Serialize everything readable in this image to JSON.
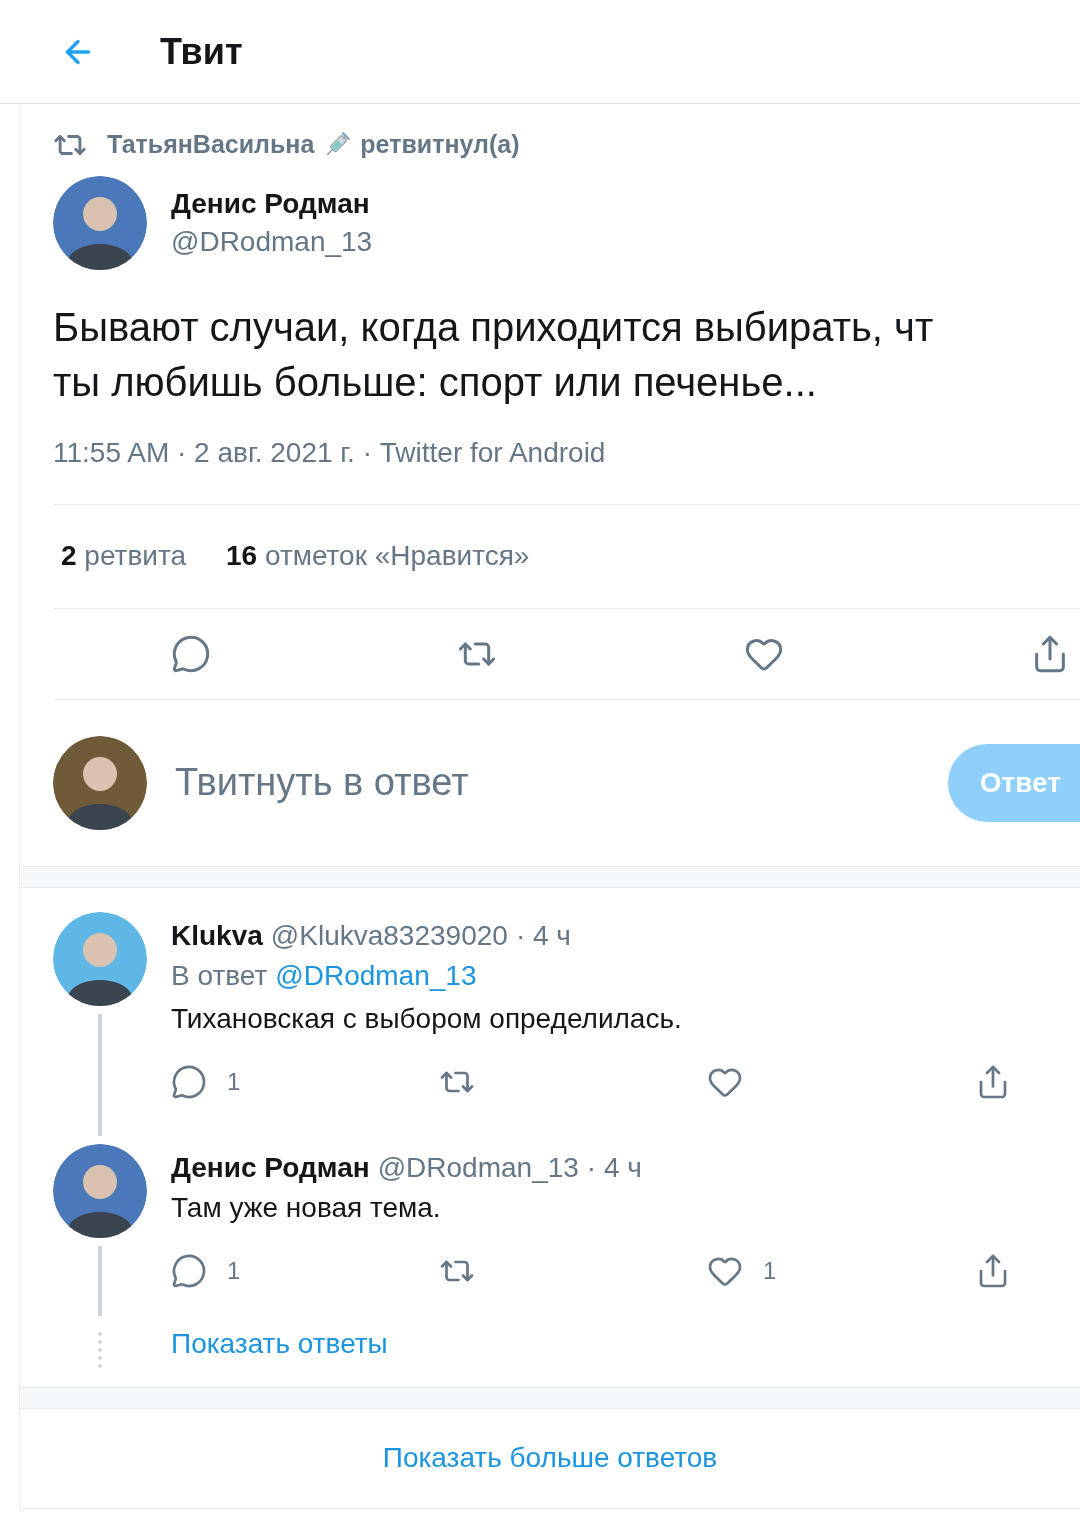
{
  "header": {
    "title": "Твит"
  },
  "retweet_banner": {
    "user": "ТатьянВасильна",
    "action": "ретвитнул(а)"
  },
  "tweet": {
    "author": "Денис Родман",
    "handle": "@DRodman_13",
    "text_lines": [
      "Бывают случаи, когда приходится выбирать, чт",
      "ты любишь больше: спорт или печенье..."
    ],
    "meta": "11:55 AM · 2 авг. 2021 г. · Twitter for Android",
    "stats": [
      {
        "count": "2",
        "label": "ретвита"
      },
      {
        "count": "16",
        "label": "отметок «Нравится»"
      }
    ],
    "actions": [
      {
        "kind": "reply"
      },
      {
        "kind": "retweet"
      },
      {
        "kind": "like"
      },
      {
        "kind": "share"
      }
    ]
  },
  "compose": {
    "placeholder": "Твитнуть в ответ",
    "button": "Ответ",
    "disabled": true
  },
  "replies": [
    {
      "author": "Klukva",
      "handle": "@Klukva83239020",
      "time": "· 4 ч",
      "reply_to_label": "В ответ",
      "reply_to": "@DRodman_13",
      "text": "Тихановская с выбором определилась.",
      "more_replies": false,
      "actions": [
        {
          "kind": "reply",
          "count": "1"
        },
        {
          "kind": "retweet"
        },
        {
          "kind": "like"
        },
        {
          "kind": "share"
        }
      ]
    },
    {
      "author": "Денис Родман",
      "handle": "@DRodman_13",
      "time": "· 4 ч",
      "text": "Там уже новая тема.",
      "more_replies": true,
      "actions": [
        {
          "kind": "reply",
          "count": "1"
        },
        {
          "kind": "retweet"
        },
        {
          "kind": "like",
          "count": "1"
        },
        {
          "kind": "share"
        }
      ]
    }
  ],
  "show_replies": "Показать ответы",
  "show_more": "Показать больше ответов"
}
